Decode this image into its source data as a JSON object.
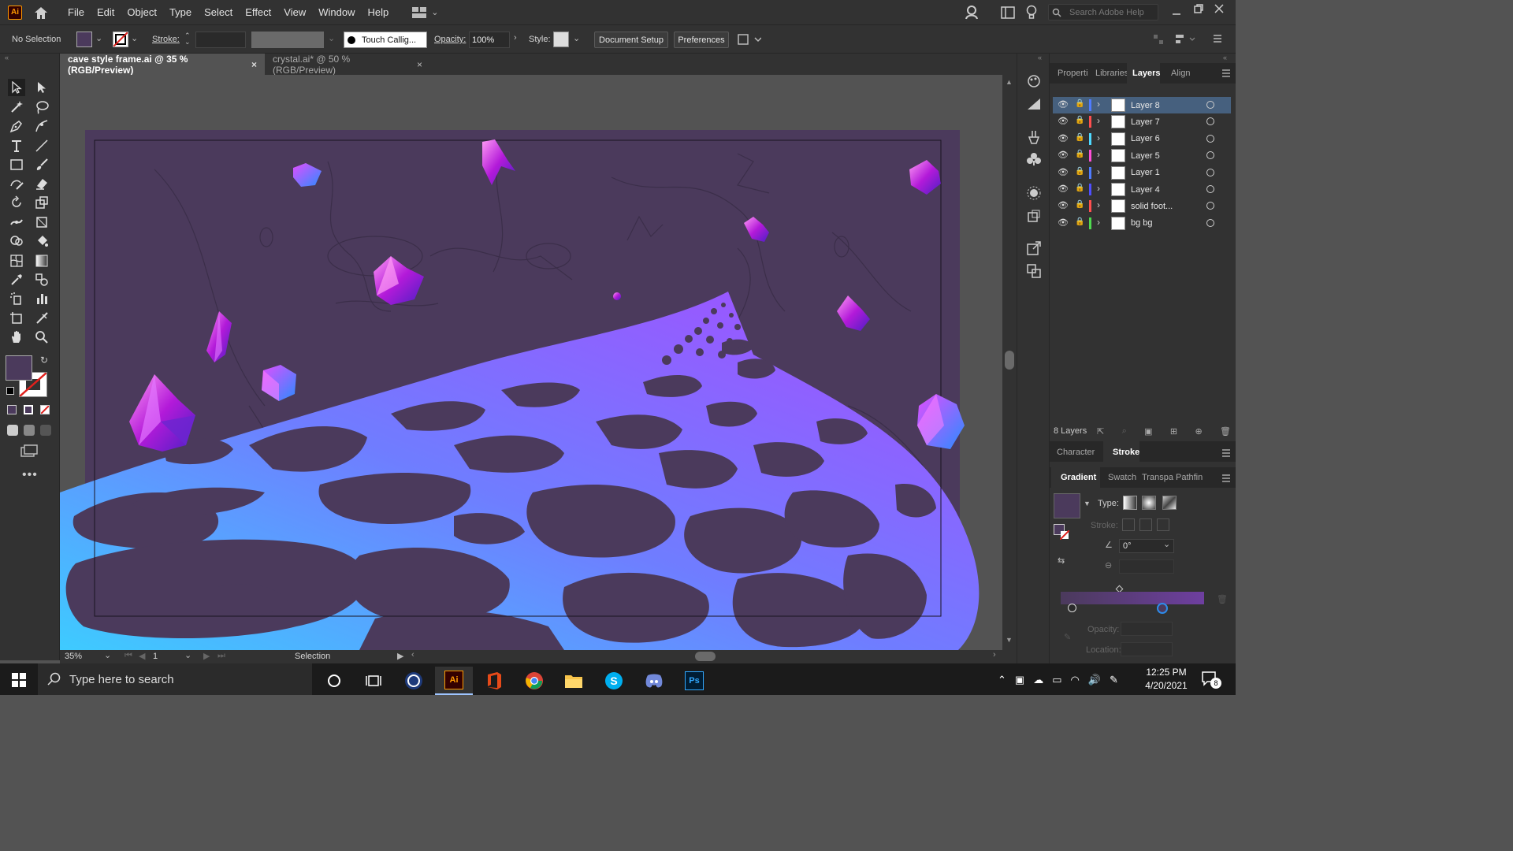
{
  "app": {
    "logo": "Ai"
  },
  "menu": [
    "File",
    "Edit",
    "Object",
    "Type",
    "Select",
    "Effect",
    "View",
    "Window",
    "Help"
  ],
  "search": {
    "placeholder": "Search Adobe Help"
  },
  "control": {
    "selection": "No Selection",
    "stroke_label": "Stroke:",
    "brush": "Touch Callig...",
    "opacity_label": "Opacity:",
    "opacity_value": "100%",
    "style_label": "Style:",
    "doc_setup": "Document Setup",
    "preferences": "Preferences"
  },
  "tabs": [
    {
      "label": "cave style frame.ai @ 35 % (RGB/Preview)",
      "active": true
    },
    {
      "label": "crystal.ai* @ 50 % (RGB/Preview)",
      "active": false
    }
  ],
  "status": {
    "zoom": "35%",
    "artboard": "1",
    "tool": "Selection"
  },
  "panel": {
    "tabs": [
      "Properti",
      "Libraries",
      "Layers",
      "Align"
    ],
    "active_tab": "Layers",
    "layers": [
      {
        "name": "Layer 8",
        "color": "#4f7cff",
        "selected": true
      },
      {
        "name": "Layer 7",
        "color": "#ff4f4f"
      },
      {
        "name": "Layer 6",
        "color": "#4fd9ff"
      },
      {
        "name": "Layer 5",
        "color": "#ff4fd8"
      },
      {
        "name": "Layer 1",
        "color": "#4f7cff"
      },
      {
        "name": "Layer 4",
        "color": "#4f4fff"
      },
      {
        "name": "solid foot...",
        "color": "#ff4f4f"
      },
      {
        "name": "bg bg",
        "color": "#4fd94f"
      }
    ],
    "layer_count": "8 Layers",
    "sub_tabs": [
      "Character",
      "Stroke"
    ],
    "sub_active": "Stroke",
    "gradient_tabs": [
      "Gradient",
      "Swatch",
      "Transpa",
      "Pathfin"
    ],
    "gradient": {
      "type_label": "Type:",
      "stroke_label": "Stroke:",
      "angle": "0°",
      "opacity_label": "Opacity:",
      "location_label": "Location:"
    }
  },
  "taskbar": {
    "search_placeholder": "Type here to search",
    "time": "12:25 PM",
    "date": "4/20/2021",
    "notifications": "8"
  },
  "colors": {
    "ui_dark": "#323232",
    "canvas_bg": "#535353",
    "artboard": "#4b3a5c",
    "floor_light": "#3ecbff",
    "floor_purple": "#9b4bff",
    "accent": "#2d8ceb"
  }
}
